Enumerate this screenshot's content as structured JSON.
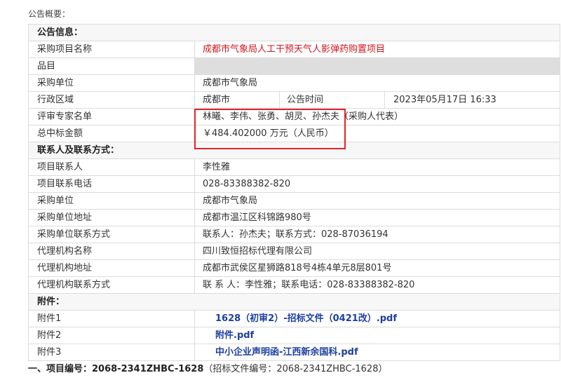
{
  "summary_title": "公告概要：",
  "announcement": {
    "heading": "公告信息：",
    "project_name_label": "采购项目名称",
    "project_name": "成都市气象局人工干预天气人影弹药购置项目",
    "category_label": "品目",
    "purchaser_label": "采购单位",
    "purchaser": "成都市气象局",
    "region_label": "行政区域",
    "region": "成都市",
    "publish_time_label": "公告时间",
    "publish_time": "2023年05月17日 16:33",
    "experts_label": "评审专家名单",
    "experts": "林曦、李伟、张勇、胡灵、孙杰夫（采购人代表）",
    "total_amount_label": "总中标金额",
    "total_amount": "￥484.402000 万元（人民币）"
  },
  "contacts": {
    "heading": "联系人及联系方式：",
    "rows": [
      {
        "label": "项目联系人",
        "value": "李性雅"
      },
      {
        "label": "项目联系电话",
        "value": "028-83388382-820"
      },
      {
        "label": "采购单位",
        "value": "成都市气象局"
      },
      {
        "label": "采购单位地址",
        "value": "成都市温江区科锦路980号"
      },
      {
        "label": "采购单位联系方式",
        "value": "联系人：孙杰夫；联系方式：028-87036194"
      },
      {
        "label": "代理机构名称",
        "value": "四川致恒招标代理有限公司"
      },
      {
        "label": "代理机构地址",
        "value": "成都市武侯区星狮路818号4栋4单元8层801号"
      },
      {
        "label": "代理机构联系方式",
        "value": "联 系 人：李性雅；联系电话：028-83388382-820"
      }
    ]
  },
  "attachments": {
    "heading": "附件：",
    "items": [
      {
        "label": "附件1",
        "file": "1628（初审2）-招标文件（0421改）.pdf"
      },
      {
        "label": "附件2",
        "file": "附件.pdf"
      },
      {
        "label": "附件3",
        "file": "中小企业声明函-江西新余国科.pdf"
      }
    ]
  },
  "project_number": {
    "main": "一、项目编号：2068-2341ZHBC-1628",
    "note": "（招标文件编号：2068-2341ZHBC-1628）"
  },
  "colors": {
    "project_name_text": "#d2161e",
    "link_text": "#1d3f9f",
    "highlight_box": "#e3242b",
    "category_fill": "#dedede",
    "border": "#dcdcdc"
  }
}
